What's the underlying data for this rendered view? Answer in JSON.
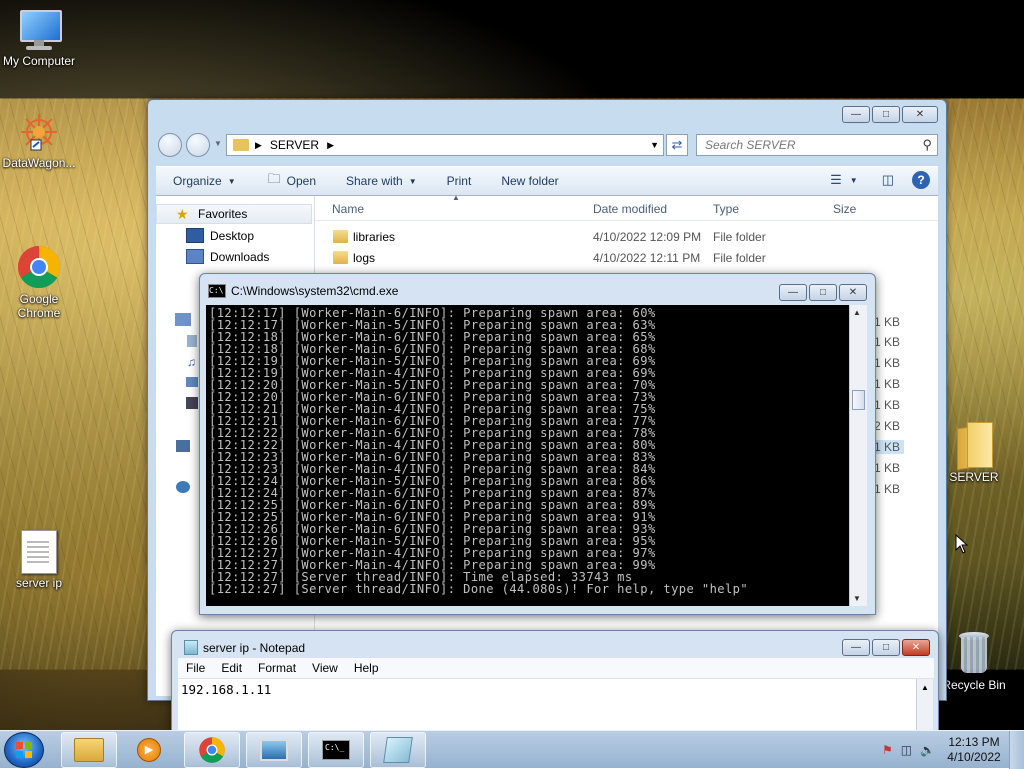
{
  "desktop": {
    "icons": [
      {
        "label": "My Computer"
      },
      {
        "label": "DataWagon..."
      },
      {
        "label": "Google\nChrome"
      },
      {
        "label": "server ip"
      },
      {
        "label": "SERVER"
      },
      {
        "label": "Recycle Bin"
      }
    ]
  },
  "explorer": {
    "address": "SERVER",
    "search_placeholder": "Search SERVER",
    "toolbar": {
      "organize": "Organize",
      "open": "Open",
      "share_with": "Share with",
      "print": "Print",
      "new_folder": "New folder"
    },
    "nav": {
      "favorites": "Favorites",
      "desktop": "Desktop",
      "downloads": "Downloads"
    },
    "columns": {
      "name": "Name",
      "date": "Date modified",
      "type": "Type",
      "size": "Size"
    },
    "rows": [
      {
        "name": "libraries",
        "date": "4/10/2022 12:09 PM",
        "type": "File folder"
      },
      {
        "name": "logs",
        "date": "4/10/2022 12:11 PM",
        "type": "File folder"
      }
    ],
    "sizes": [
      "1 KB",
      "1 KB",
      "1 KB",
      "1 KB",
      "1 KB",
      "2 KB",
      "1 KB",
      "1 KB",
      "1 KB"
    ]
  },
  "cmd": {
    "title": "C:\\Windows\\system32\\cmd.exe",
    "lines": [
      "[12:12:17] [Worker-Main-6/INFO]: Preparing spawn area: 60%",
      "[12:12:17] [Worker-Main-5/INFO]: Preparing spawn area: 63%",
      "[12:12:18] [Worker-Main-6/INFO]: Preparing spawn area: 65%",
      "[12:12:18] [Worker-Main-6/INFO]: Preparing spawn area: 68%",
      "[12:12:19] [Worker-Main-5/INFO]: Preparing spawn area: 69%",
      "[12:12:19] [Worker-Main-4/INFO]: Preparing spawn area: 69%",
      "[12:12:20] [Worker-Main-5/INFO]: Preparing spawn area: 70%",
      "[12:12:20] [Worker-Main-6/INFO]: Preparing spawn area: 73%",
      "[12:12:21] [Worker-Main-4/INFO]: Preparing spawn area: 75%",
      "[12:12:21] [Worker-Main-6/INFO]: Preparing spawn area: 77%",
      "[12:12:22] [Worker-Main-6/INFO]: Preparing spawn area: 78%",
      "[12:12:22] [Worker-Main-4/INFO]: Preparing spawn area: 80%",
      "[12:12:23] [Worker-Main-6/INFO]: Preparing spawn area: 83%",
      "[12:12:23] [Worker-Main-4/INFO]: Preparing spawn area: 84%",
      "[12:12:24] [Worker-Main-5/INFO]: Preparing spawn area: 86%",
      "[12:12:24] [Worker-Main-6/INFO]: Preparing spawn area: 87%",
      "[12:12:25] [Worker-Main-6/INFO]: Preparing spawn area: 89%",
      "[12:12:25] [Worker-Main-6/INFO]: Preparing spawn area: 91%",
      "[12:12:26] [Worker-Main-6/INFO]: Preparing spawn area: 93%",
      "[12:12:26] [Worker-Main-5/INFO]: Preparing spawn area: 95%",
      "[12:12:27] [Worker-Main-4/INFO]: Preparing spawn area: 97%",
      "[12:12:27] [Worker-Main-4/INFO]: Preparing spawn area: 99%",
      "[12:12:27] [Server thread/INFO]: Time elapsed: 33743 ms",
      "[12:12:27] [Server thread/INFO]: Done (44.080s)! For help, type \"help\""
    ]
  },
  "notepad": {
    "title": "server ip - Notepad",
    "menu": [
      "File",
      "Edit",
      "Format",
      "View",
      "Help"
    ],
    "content": "192.168.1.11"
  },
  "taskbar": {
    "time": "12:13 PM",
    "date": "4/10/2022"
  }
}
